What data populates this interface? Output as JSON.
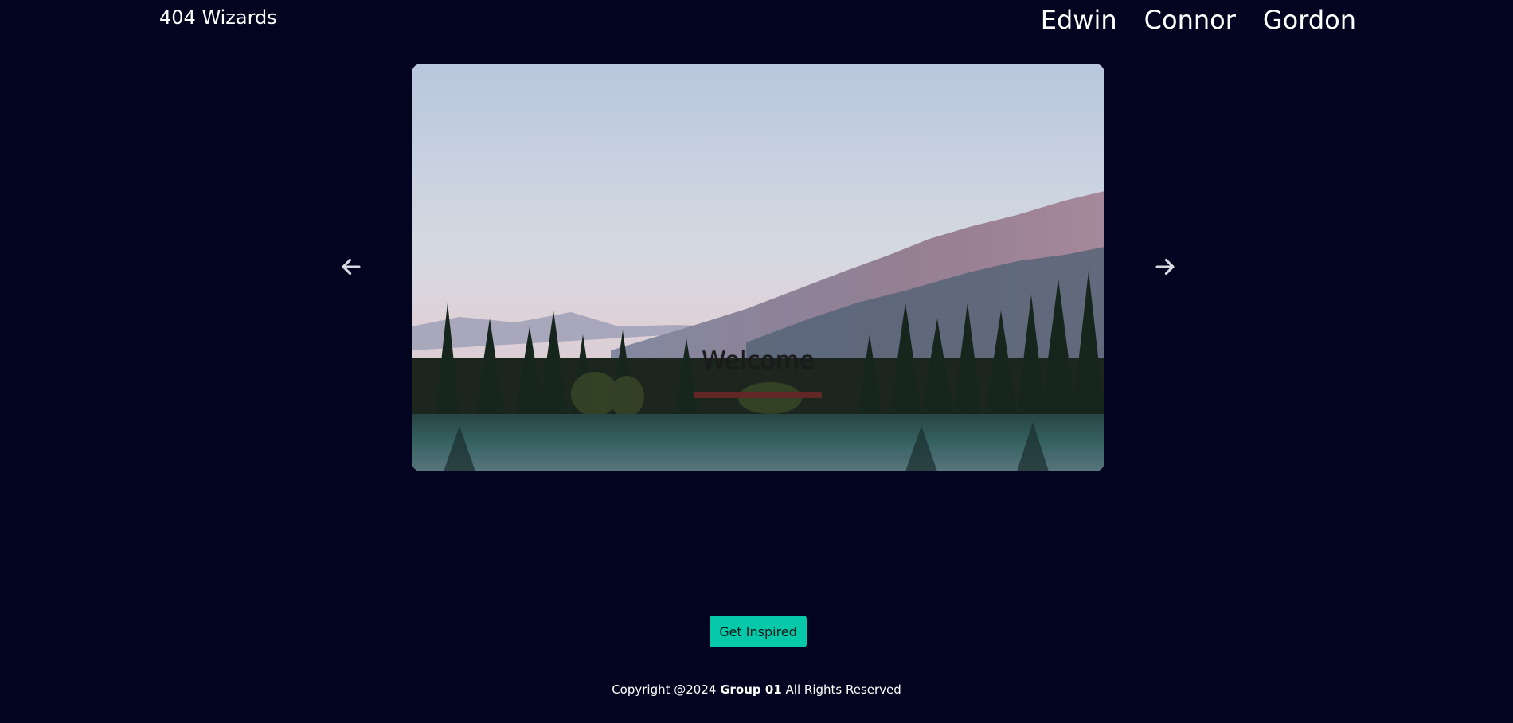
{
  "brand": "404 Wizards",
  "nav": {
    "items": [
      "Edwin",
      "Connor",
      "Gordon"
    ]
  },
  "carousel": {
    "caption": "Welcome",
    "prev_icon": "arrow-left-icon",
    "next_icon": "arrow-right-icon"
  },
  "cta": {
    "label": "Get Inspired",
    "color": "#06c9a9"
  },
  "footer": {
    "prefix": "Copyright @2024",
    "group": "Group 01",
    "suffix": "All Rights Reserved"
  },
  "colors": {
    "background": "#03041f",
    "accent": "#06c9a9"
  }
}
